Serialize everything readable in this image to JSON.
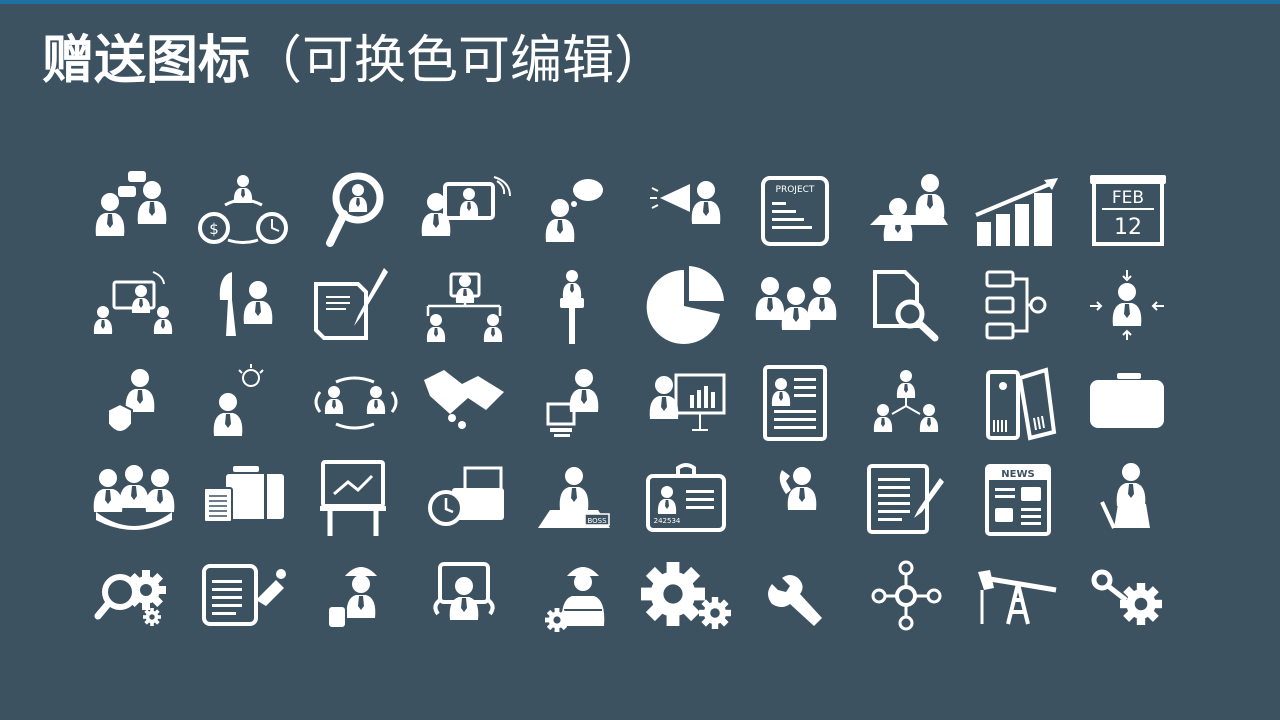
{
  "slide": {
    "title_main": "赠送图标",
    "title_paren": "（可换色可编辑）",
    "colors": {
      "background": "#3d5261",
      "accent_bar": "#1f6fa1",
      "icon": "#ffffff"
    }
  },
  "icons": {
    "project_label": "PROJECT",
    "calendar_month": "FEB",
    "calendar_day": "12",
    "badge_id": "242534",
    "desk_plate": "BOSS",
    "news_label": "NEWS",
    "dollar_sign": "$"
  }
}
